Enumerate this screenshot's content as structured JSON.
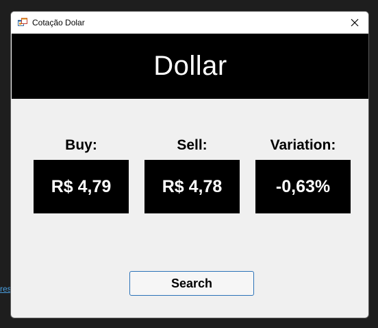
{
  "background": {
    "link_fragment": "res"
  },
  "window": {
    "title": "Cotação Dolar",
    "app_icon": "windows-form-icon",
    "close_icon": "close-icon"
  },
  "header": {
    "title": "Dollar"
  },
  "quotes": {
    "buy": {
      "label": "Buy:",
      "value": "R$ 4,79"
    },
    "sell": {
      "label": "Sell:",
      "value": "R$ 4,78"
    },
    "variation": {
      "label": "Variation:",
      "value": "-0,63%"
    }
  },
  "actions": {
    "search_label": "Search"
  },
  "colors": {
    "desktop_bg": "#1e1e1e",
    "window_bg": "#f0f0f0",
    "banner_bg": "#000000",
    "button_border": "#2a72b8",
    "link": "#4a9fe0"
  }
}
